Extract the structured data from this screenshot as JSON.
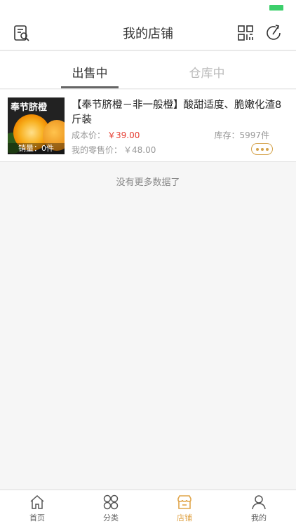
{
  "nav": {
    "title": "我的店铺",
    "icons": [
      "search-list-icon",
      "qr-code-icon",
      "share-icon"
    ]
  },
  "tabs": [
    {
      "label": "出售中",
      "selected": true
    },
    {
      "label": "仓库中",
      "selected": false
    }
  ],
  "product": {
    "thumb_title": "奉节脐橙",
    "sales_overlay": "销量：0件",
    "title": "【奉节脐橙－非一般橙】酸甜适度、脆嫩化渣8斤装",
    "cost_label": "成本价：",
    "cost_value": "￥39.00",
    "stock": "库存：5997件",
    "retail_label": "我的零售价：",
    "retail_value": "￥48.00"
  },
  "list_footer": "没有更多数据了",
  "tabbar": {
    "items": [
      {
        "label": "首页",
        "icon": "home-icon"
      },
      {
        "label": "分类",
        "icon": "category-icon"
      },
      {
        "label": "店铺",
        "icon": "shop-icon",
        "selected": true
      },
      {
        "label": "我的",
        "icon": "user-icon"
      }
    ]
  },
  "colors": {
    "accent": "#e0a54a",
    "price_red": "#e53b2f",
    "battery_green": "#3ccf6b"
  }
}
